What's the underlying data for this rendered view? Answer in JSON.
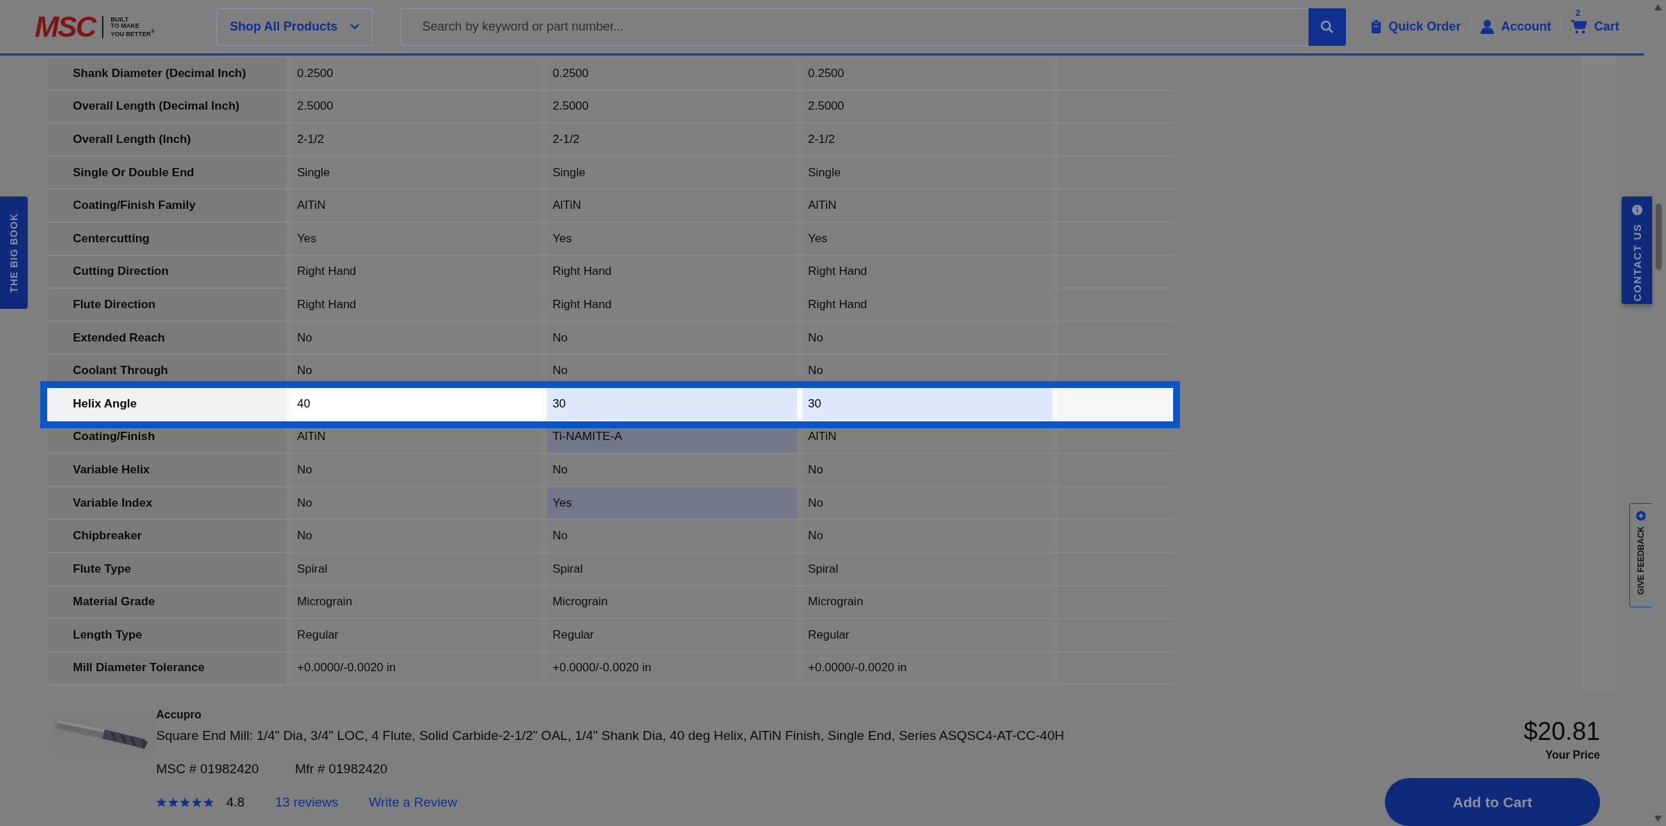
{
  "header": {
    "logo": "MSC",
    "tagline": [
      "BUILT",
      "TO MAKE",
      "YOU BETTER$^{®}$"
    ],
    "shop_button": "Shop All Products",
    "search": {
      "placeholder": "Search by keyword or part number..."
    },
    "links": [
      {
        "label": "Quick Order",
        "kind": "clipboard"
      },
      {
        "label": "Account",
        "kind": "person"
      },
      {
        "label": "Cart",
        "kind": "cart",
        "badge": "2"
      }
    ]
  },
  "side_tabs": {
    "left": "THE BIG BOOK",
    "contact": "CONTACT US",
    "feedback": "GIVE FEEDBACK"
  },
  "specs": [
    {
      "label": "Shank Diameter (Decimal Inch)",
      "highlighted": false,
      "cells": [
        {
          "text": "0.2500",
          "differs": false
        },
        {
          "text": "0.2500",
          "differs": false
        },
        {
          "text": "0.2500",
          "differs": false
        }
      ]
    },
    {
      "label": "Overall Length (Decimal Inch)",
      "highlighted": false,
      "cells": [
        {
          "text": "2.5000",
          "differs": false
        },
        {
          "text": "2.5000",
          "differs": false
        },
        {
          "text": "2.5000",
          "differs": false
        }
      ]
    },
    {
      "label": "Overall Length (Inch)",
      "highlighted": false,
      "cells": [
        {
          "text": "2-1/2",
          "differs": false
        },
        {
          "text": "2-1/2",
          "differs": false
        },
        {
          "text": "2-1/2",
          "differs": false
        }
      ]
    },
    {
      "label": "Single Or Double End",
      "highlighted": false,
      "cells": [
        {
          "text": "Single",
          "differs": false
        },
        {
          "text": "Single",
          "differs": false
        },
        {
          "text": "Single",
          "differs": false
        }
      ]
    },
    {
      "label": "Coating/Finish Family",
      "highlighted": false,
      "cells": [
        {
          "text": "AlTiN",
          "differs": false
        },
        {
          "text": "AlTiN",
          "differs": false
        },
        {
          "text": "AlTiN",
          "differs": false
        }
      ]
    },
    {
      "label": "Centercutting",
      "highlighted": false,
      "cells": [
        {
          "text": "Yes",
          "differs": false
        },
        {
          "text": "Yes",
          "differs": false
        },
        {
          "text": "Yes",
          "differs": false
        }
      ]
    },
    {
      "label": "Cutting Direction",
      "highlighted": false,
      "cells": [
        {
          "text": "Right Hand",
          "differs": false
        },
        {
          "text": "Right Hand",
          "differs": false
        },
        {
          "text": "Right Hand",
          "differs": false
        }
      ]
    },
    {
      "label": "Flute Direction",
      "highlighted": false,
      "cells": [
        {
          "text": "Right Hand",
          "differs": false
        },
        {
          "text": "Right Hand",
          "differs": false
        },
        {
          "text": "Right Hand",
          "differs": false
        }
      ]
    },
    {
      "label": "Extended Reach",
      "highlighted": false,
      "cells": [
        {
          "text": "No",
          "differs": false
        },
        {
          "text": "No",
          "differs": false
        },
        {
          "text": "No",
          "differs": false
        }
      ]
    },
    {
      "label": "Coolant Through",
      "highlighted": false,
      "cells": [
        {
          "text": "No",
          "differs": false
        },
        {
          "text": "No",
          "differs": false
        },
        {
          "text": "No",
          "differs": false
        }
      ]
    },
    {
      "label": "Helix Angle",
      "highlighted": true,
      "cells": [
        {
          "text": "40",
          "differs": false
        },
        {
          "text": "30",
          "differs": true
        },
        {
          "text": "30",
          "differs": true
        }
      ]
    },
    {
      "label": "Coating/Finish",
      "highlighted": false,
      "cells": [
        {
          "text": "AlTiN",
          "differs": false
        },
        {
          "text": "Ti-NAMITE-A",
          "differs": true
        },
        {
          "text": "AlTiN",
          "differs": false
        }
      ]
    },
    {
      "label": "Variable Helix",
      "highlighted": false,
      "cells": [
        {
          "text": "No",
          "differs": false
        },
        {
          "text": "No",
          "differs": false
        },
        {
          "text": "No",
          "differs": false
        }
      ]
    },
    {
      "label": "Variable Index",
      "highlighted": false,
      "cells": [
        {
          "text": "No",
          "differs": false
        },
        {
          "text": "Yes",
          "differs": true
        },
        {
          "text": "No",
          "differs": false
        }
      ]
    },
    {
      "label": "Chipbreaker",
      "highlighted": false,
      "cells": [
        {
          "text": "No",
          "differs": false
        },
        {
          "text": "No",
          "differs": false
        },
        {
          "text": "No",
          "differs": false
        }
      ]
    },
    {
      "label": "Flute Type",
      "highlighted": false,
      "cells": [
        {
          "text": "Spiral",
          "differs": false
        },
        {
          "text": "Spiral",
          "differs": false
        },
        {
          "text": "Spiral",
          "differs": false
        }
      ]
    },
    {
      "label": "Material Grade",
      "highlighted": false,
      "cells": [
        {
          "text": "Micrograin",
          "differs": false
        },
        {
          "text": "Micrograin",
          "differs": false
        },
        {
          "text": "Micrograin",
          "differs": false
        }
      ]
    },
    {
      "label": "Length Type",
      "highlighted": false,
      "cells": [
        {
          "text": "Regular",
          "differs": false
        },
        {
          "text": "Regular",
          "differs": false
        },
        {
          "text": "Regular",
          "differs": false
        }
      ]
    },
    {
      "label": "Mill Diameter Tolerance",
      "highlighted": false,
      "cells": [
        {
          "text": "+0.0000/-0.0020 in",
          "differs": false
        },
        {
          "text": "+0.0000/-0.0020 in",
          "differs": false
        },
        {
          "text": "+0.0000/-0.0020 in",
          "differs": false
        }
      ]
    }
  ],
  "product": {
    "brand": "Accupro",
    "title": "Square End Mill: 1/4\" Dia, 3/4\" LOC, 4 Flute, Solid Carbide-2-1/2\" OAL, 1/4\" Shank Dia, 40 deg Helix, AlTiN Finish, Single End, Series ASQSC4-AT-CC-40H",
    "msc_number": "MSC # 01982420",
    "mfr_number": "Mfr # 01982420",
    "stars": 5,
    "rating": "4.8",
    "reviews_link": "13 reviews",
    "write_review_link": "Write a Review",
    "price": "$20.81",
    "price_label": "Your Price",
    "add_button": "Add to Cart"
  }
}
